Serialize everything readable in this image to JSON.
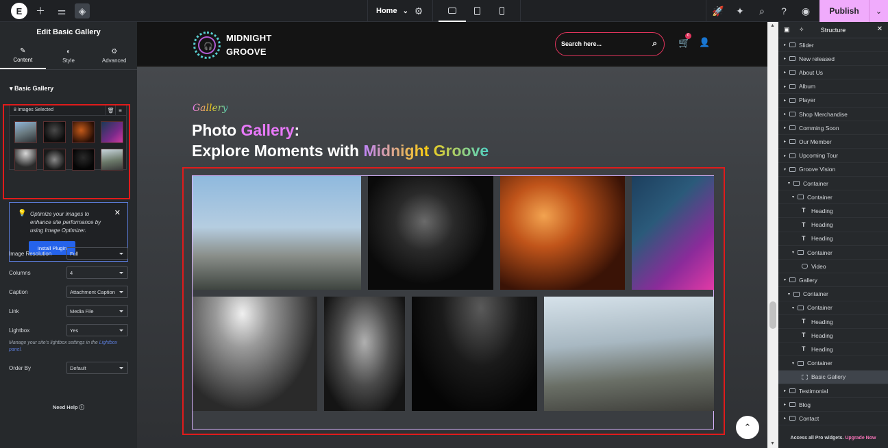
{
  "topbar": {
    "page_select": "Home",
    "publish_label": "Publish"
  },
  "left_panel": {
    "title": "Edit Basic Gallery",
    "tabs": [
      {
        "label": "Content",
        "icon": "pencil-icon"
      },
      {
        "label": "Style",
        "icon": "half-circle-icon"
      },
      {
        "label": "Advanced",
        "icon": "gear-icon"
      }
    ],
    "section_title": "Basic Gallery",
    "images_selected": "8 Images Selected",
    "optimizer_text": "Optimize your images to enhance site performance by using Image Optimizer.",
    "install_button": "Install Plugin",
    "controls": [
      {
        "label": "Image Resolution",
        "value": "Full"
      },
      {
        "label": "Columns",
        "value": "4"
      },
      {
        "label": "Caption",
        "value": "Attachment Caption"
      },
      {
        "label": "Link",
        "value": "Media File"
      },
      {
        "label": "Lightbox",
        "value": "Yes"
      }
    ],
    "lightbox_note": "Manage your site's lightbox settings in the",
    "lightbox_link": "Lightbox panel",
    "order_by": {
      "label": "Order By",
      "value": "Default"
    },
    "need_help": "Need Help"
  },
  "site": {
    "brand_line1": "MIDNIGHT",
    "brand_line2": "GROOVE",
    "search_placeholder": "Search here...",
    "cart_count": "0",
    "gallery_label": "Gallery",
    "heading_part1": "Photo ",
    "heading_part2": "Gallery",
    "heading_part3": ":",
    "heading_line2_part1": "Explore Moments with ",
    "heading_line2_part2": "Midnight Groove"
  },
  "structure": {
    "title": "Structure",
    "items": [
      {
        "label": "Slider",
        "level": 0,
        "icon": "box"
      },
      {
        "label": "New released",
        "level": 0,
        "icon": "box"
      },
      {
        "label": "About Us",
        "level": 0,
        "icon": "box"
      },
      {
        "label": "Album",
        "level": 0,
        "icon": "box"
      },
      {
        "label": "Player",
        "level": 0,
        "icon": "box"
      },
      {
        "label": "Shop Merchandise",
        "level": 0,
        "icon": "box"
      },
      {
        "label": "Comming Soon",
        "level": 0,
        "icon": "box"
      },
      {
        "label": "Our Member",
        "level": 0,
        "icon": "box"
      },
      {
        "label": "Upcoming Tour",
        "level": 0,
        "icon": "box"
      },
      {
        "label": "Groove Vision",
        "level": 0,
        "icon": "box",
        "open": true
      },
      {
        "label": "Container",
        "level": 1,
        "icon": "box",
        "open": true
      },
      {
        "label": "Container",
        "level": 2,
        "icon": "box",
        "open": true
      },
      {
        "label": "Heading",
        "level": 3,
        "icon": "T"
      },
      {
        "label": "Heading",
        "level": 3,
        "icon": "T"
      },
      {
        "label": "Heading",
        "level": 3,
        "icon": "T"
      },
      {
        "label": "Container",
        "level": 2,
        "icon": "box",
        "open": true
      },
      {
        "label": "Video",
        "level": 3,
        "icon": "video"
      },
      {
        "label": "Gallery",
        "level": 0,
        "icon": "box",
        "open": true
      },
      {
        "label": "Container",
        "level": 1,
        "icon": "box",
        "open": true
      },
      {
        "label": "Container",
        "level": 2,
        "icon": "box",
        "open": true
      },
      {
        "label": "Heading",
        "level": 3,
        "icon": "T"
      },
      {
        "label": "Heading",
        "level": 3,
        "icon": "T"
      },
      {
        "label": "Heading",
        "level": 3,
        "icon": "T"
      },
      {
        "label": "Container",
        "level": 2,
        "icon": "box",
        "open": true
      },
      {
        "label": "Basic Gallery",
        "level": 3,
        "icon": "gallery",
        "selected": true
      },
      {
        "label": "Testimonial",
        "level": 0,
        "icon": "box"
      },
      {
        "label": "Blog",
        "level": 0,
        "icon": "box"
      },
      {
        "label": "Contact",
        "level": 0,
        "icon": "box"
      }
    ],
    "footer_text": "Access all Pro widgets.",
    "footer_link": "Upgrade Now"
  },
  "colors": {
    "accent_pink": "#f0abfc",
    "highlight_red": "#e01b1b",
    "editor_dark": "#26292c"
  }
}
